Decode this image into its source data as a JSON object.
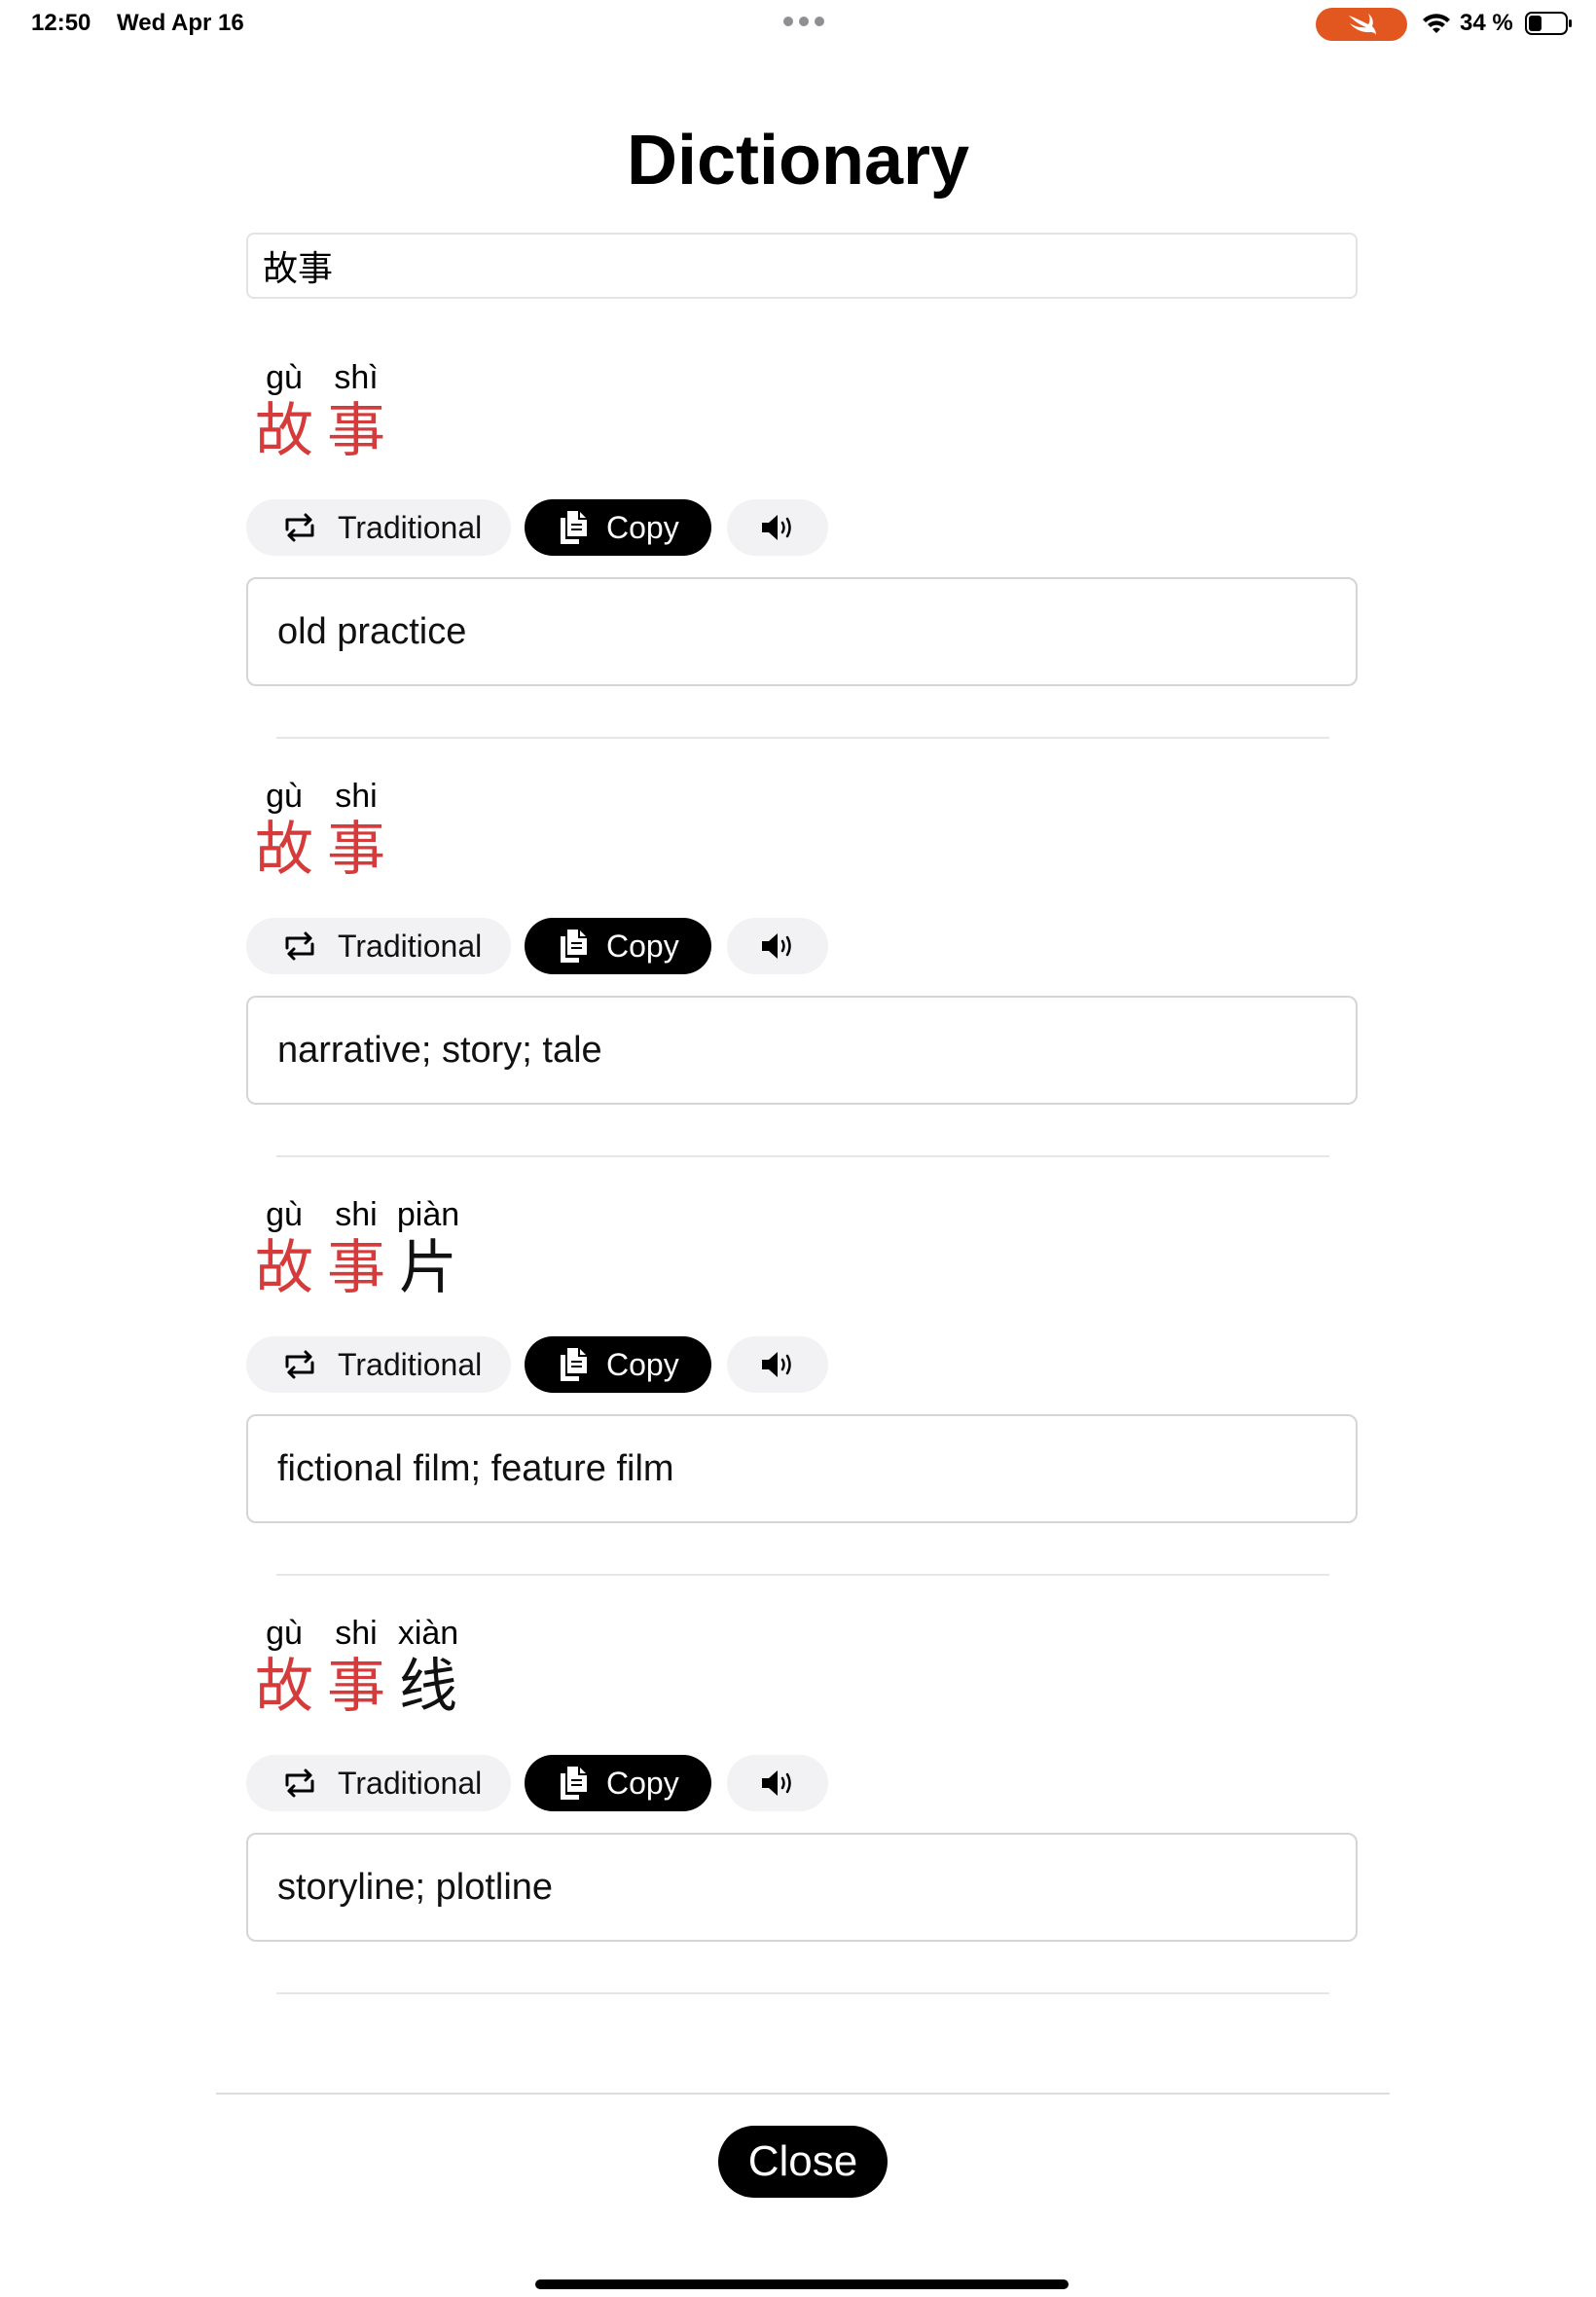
{
  "status_bar": {
    "time": "12:50",
    "date": "Wed Apr 16",
    "battery": "34 %"
  },
  "title": "Dictionary",
  "search": {
    "value": "故事"
  },
  "buttons": {
    "traditional": "Traditional",
    "copy": "Copy",
    "close": "Close"
  },
  "entries": [
    {
      "pinyin": [
        "gù",
        "shì"
      ],
      "characters": [
        "故",
        "事"
      ],
      "definition": "old practice"
    },
    {
      "pinyin": [
        "gù",
        "shi"
      ],
      "characters": [
        "故",
        "事"
      ],
      "definition": "narrative; story; tale"
    },
    {
      "pinyin": [
        "gù",
        "shi",
        "piàn"
      ],
      "characters": [
        "故",
        "事",
        "片"
      ],
      "definition": "fictional film; feature film"
    },
    {
      "pinyin": [
        "gù",
        "shi",
        "xiàn"
      ],
      "characters": [
        "故",
        "事",
        "线"
      ],
      "definition": "storyline; plotline"
    }
  ],
  "colors": {
    "query_match": "#d63b3b",
    "swift_badge": "#e2571f",
    "button_dark": "#000000",
    "button_light": "#f2f2f4"
  }
}
